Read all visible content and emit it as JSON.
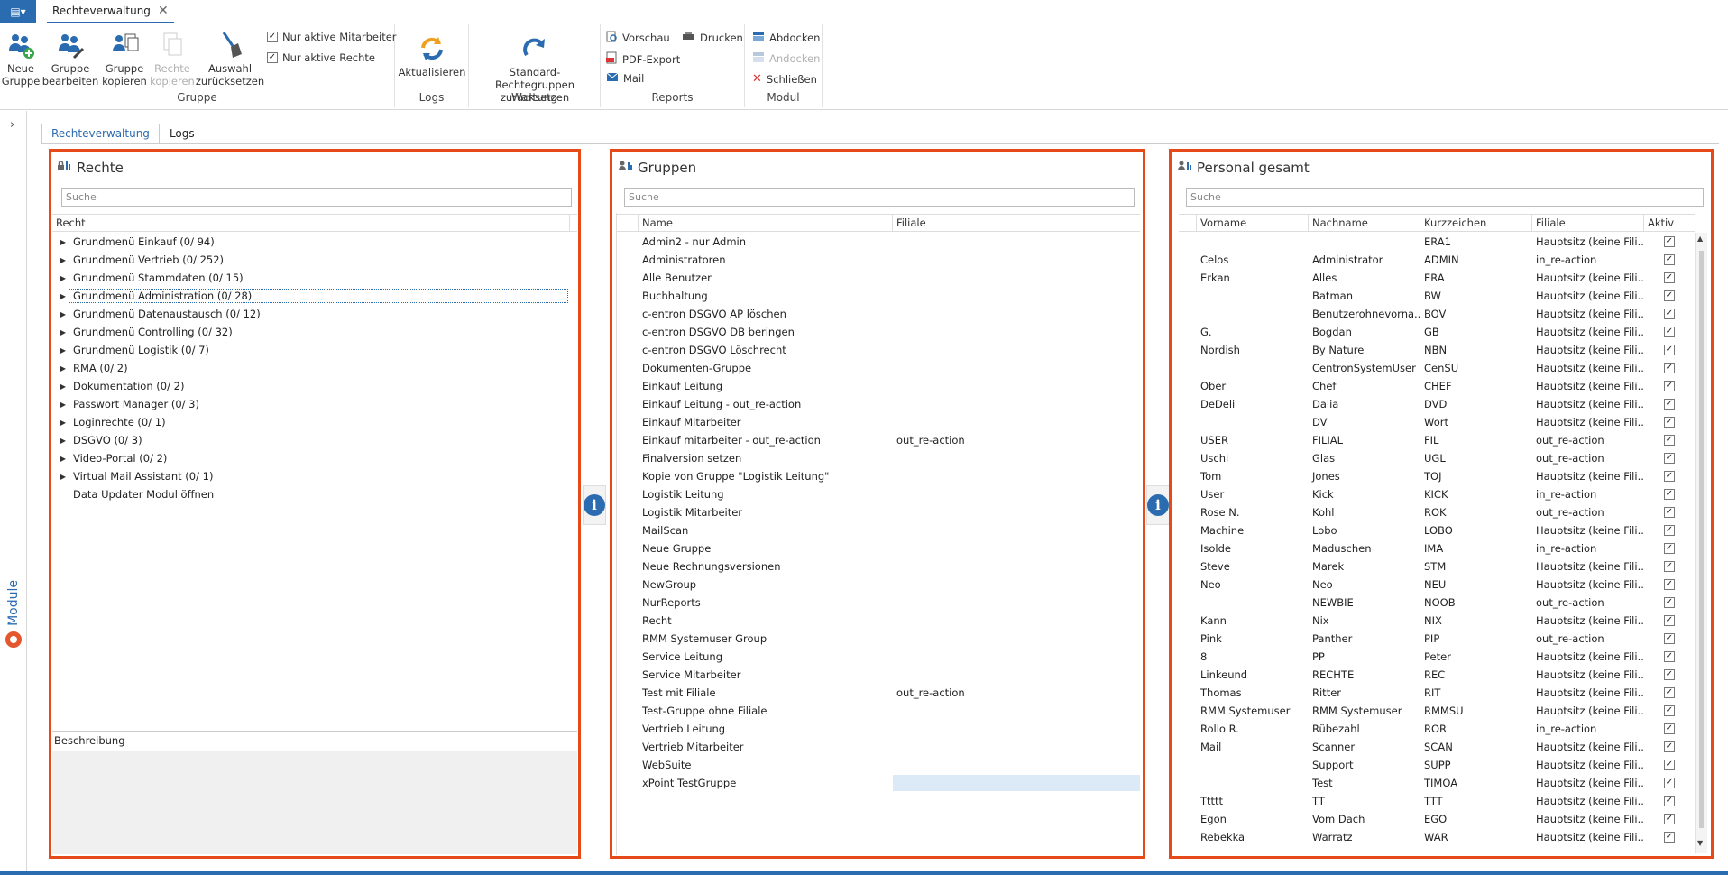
{
  "app": {
    "menu_glyph": "▤▾",
    "doc_tab": "Rechteverwaltung",
    "close_glyph": "✕"
  },
  "ribbon": {
    "gruppe": {
      "label": "Gruppe",
      "new_group": [
        "Neue",
        "Gruppe"
      ],
      "edit_group": [
        "Gruppe",
        "bearbeiten"
      ],
      "copy_group": [
        "Gruppe",
        "kopieren"
      ],
      "copy_rights": [
        "Rechte",
        "kopieren"
      ],
      "reset_selection": [
        "Auswahl",
        "zurücksetzen"
      ],
      "only_active_staff": "Nur aktive Mitarbeiter",
      "only_active_rights": "Nur aktive Rechte"
    },
    "logs": {
      "label": "Logs",
      "refresh": "Aktualisieren"
    },
    "wartung": {
      "label": "Wartung",
      "reset_std": [
        "Standard-Rechtegruppen",
        "zurücksetzen"
      ]
    },
    "reports": {
      "label": "Reports",
      "preview": "Vorschau",
      "print": "Drucken",
      "pdf": "PDF-Export",
      "mail": "Mail"
    },
    "modul": {
      "label": "Modul",
      "dock_out": "Abdocken",
      "dock_in": "Andocken",
      "close": "Schließen"
    }
  },
  "side": {
    "module_label": "Module"
  },
  "tabs": [
    "Rechteverwaltung",
    "Logs"
  ],
  "rechte": {
    "title": "Rechte",
    "search_placeholder": "Suche",
    "col": "Recht",
    "items": [
      "Grundmenü Einkauf (0/ 94)",
      "Grundmenü Vertrieb (0/ 252)",
      "Grundmenü Stammdaten (0/ 15)",
      "Grundmenü Administration (0/ 28)",
      "Grundmenü Datenaustausch (0/ 12)",
      "Grundmenü Controlling (0/ 32)",
      "Grundmenü Logistik (0/ 7)",
      "RMA (0/ 2)",
      "Dokumentation (0/ 2)",
      "Passwort Manager (0/ 3)",
      "Loginrechte (0/ 1)",
      "DSGVO (0/ 3)",
      "Video-Portal (0/ 2)",
      "Virtual Mail Assistant (0/ 1)",
      "Data Updater Modul öffnen"
    ],
    "description_label": "Beschreibung"
  },
  "gruppen": {
    "title": "Gruppen",
    "search_placeholder": "Suche",
    "cols": [
      "Name",
      "Filiale"
    ],
    "rows": [
      [
        "Admin2 - nur Admin",
        ""
      ],
      [
        "Administratoren",
        ""
      ],
      [
        "Alle Benutzer",
        ""
      ],
      [
        "Buchhaltung",
        ""
      ],
      [
        "c-entron DSGVO AP löschen",
        ""
      ],
      [
        "c-entron DSGVO DB beringen",
        ""
      ],
      [
        "c-entron DSGVO Löschrecht",
        ""
      ],
      [
        "Dokumenten-Gruppe",
        ""
      ],
      [
        "Einkauf Leitung",
        ""
      ],
      [
        "Einkauf Leitung - out_re-action",
        ""
      ],
      [
        "Einkauf Mitarbeiter",
        ""
      ],
      [
        "Einkauf mitarbeiter - out_re-action",
        "out_re-action"
      ],
      [
        "Finalversion setzen",
        ""
      ],
      [
        "Kopie von Gruppe \"Logistik Leitung\"",
        ""
      ],
      [
        "Logistik Leitung",
        ""
      ],
      [
        "Logistik Mitarbeiter",
        ""
      ],
      [
        "MailScan",
        ""
      ],
      [
        "Neue Gruppe",
        ""
      ],
      [
        "Neue Rechnungsversionen",
        ""
      ],
      [
        "NewGroup",
        ""
      ],
      [
        "NurReports",
        ""
      ],
      [
        "Recht",
        ""
      ],
      [
        "RMM Systemuser Group",
        ""
      ],
      [
        "Service Leitung",
        ""
      ],
      [
        "Service Mitarbeiter",
        ""
      ],
      [
        "Test mit Filiale",
        "out_re-action"
      ],
      [
        "Test-Gruppe ohne Filiale",
        ""
      ],
      [
        "Vertrieb Leitung",
        ""
      ],
      [
        "Vertrieb Mitarbeiter",
        ""
      ],
      [
        "WebSuite",
        ""
      ],
      [
        "xPoint TestGruppe",
        ""
      ]
    ]
  },
  "personal": {
    "title": "Personal gesamt",
    "search_placeholder": "Suche",
    "cols": [
      "Vorname",
      "Nachname",
      "Kurzzeichen",
      "Filiale",
      "Aktiv"
    ],
    "check_glyph": "✓",
    "rows": [
      [
        "",
        "",
        "ERA1",
        "Hauptsitz (keine Fili..."
      ],
      [
        "Celos",
        "Administrator",
        "ADMIN",
        "in_re-action"
      ],
      [
        "Erkan",
        "Alles",
        "ERA",
        "Hauptsitz (keine Fili..."
      ],
      [
        "",
        "Batman",
        "BW",
        "Hauptsitz (keine Fili..."
      ],
      [
        "",
        "Benutzerohnevorna...",
        "BOV",
        "Hauptsitz (keine Fili..."
      ],
      [
        "G.",
        "Bogdan",
        "GB",
        "Hauptsitz (keine Fili..."
      ],
      [
        "Nordish",
        "By Nature",
        "NBN",
        "Hauptsitz (keine Fili..."
      ],
      [
        "",
        "CentronSystemUser",
        "CenSU",
        "Hauptsitz (keine Fili..."
      ],
      [
        "Ober",
        "Chef",
        "CHEF",
        "Hauptsitz (keine Fili..."
      ],
      [
        "DeDeli",
        "Dalia",
        "DVD",
        "Hauptsitz (keine Fili..."
      ],
      [
        "",
        "DV",
        "Wort",
        "Hauptsitz (keine Fili..."
      ],
      [
        "USER",
        "FILIAL",
        "FIL",
        "out_re-action"
      ],
      [
        "Uschi",
        "Glas",
        "UGL",
        "out_re-action"
      ],
      [
        "Tom",
        "Jones",
        "TOJ",
        "Hauptsitz (keine Fili..."
      ],
      [
        "User",
        "Kick",
        "KICK",
        "in_re-action"
      ],
      [
        "Rose N.",
        "Kohl",
        "ROK",
        "out_re-action"
      ],
      [
        "Machine",
        "Lobo",
        "LOBO",
        "Hauptsitz (keine Fili..."
      ],
      [
        "Isolde",
        "Maduschen",
        "IMA",
        "in_re-action"
      ],
      [
        "Steve",
        "Marek",
        "STM",
        "Hauptsitz (keine Fili..."
      ],
      [
        "Neo",
        "Neo",
        "NEU",
        "Hauptsitz (keine Fili..."
      ],
      [
        "",
        "NEWBIE",
        "NOOB",
        "out_re-action"
      ],
      [
        "Kann",
        "Nix",
        "NIX",
        "Hauptsitz (keine Fili..."
      ],
      [
        "Pink",
        "Panther",
        "PIP",
        "out_re-action"
      ],
      [
        "8",
        "PP",
        "Peter",
        "Hauptsitz (keine Fili..."
      ],
      [
        "Linkeund",
        "RECHTE",
        "REC",
        "Hauptsitz (keine Fili..."
      ],
      [
        "Thomas",
        "Ritter",
        "RIT",
        "Hauptsitz (keine Fili..."
      ],
      [
        "RMM Systemuser",
        "RMM Systemuser",
        "RMMSU",
        "Hauptsitz (keine Fili..."
      ],
      [
        "Rollo R.",
        "Rübezahl",
        "ROR",
        "in_re-action"
      ],
      [
        "Mail",
        "Scanner",
        "SCAN",
        "Hauptsitz (keine Fili..."
      ],
      [
        "",
        "Support",
        "SUPP",
        "Hauptsitz (keine Fili..."
      ],
      [
        "",
        "Test",
        "TIMOA",
        "Hauptsitz (keine Fili..."
      ],
      [
        "Ttttt",
        "TT",
        "TTT",
        "Hauptsitz (keine Fili..."
      ],
      [
        "Egon",
        "Vom Dach",
        "EGO",
        "Hauptsitz (keine Fili..."
      ],
      [
        "Rebekka",
        "Warratz",
        "WAR",
        "Hauptsitz (keine Fili..."
      ]
    ]
  },
  "colors": {
    "accent": "#2b6cb0",
    "highlight_border": "#e64a19",
    "selection": "#dceaf8"
  }
}
